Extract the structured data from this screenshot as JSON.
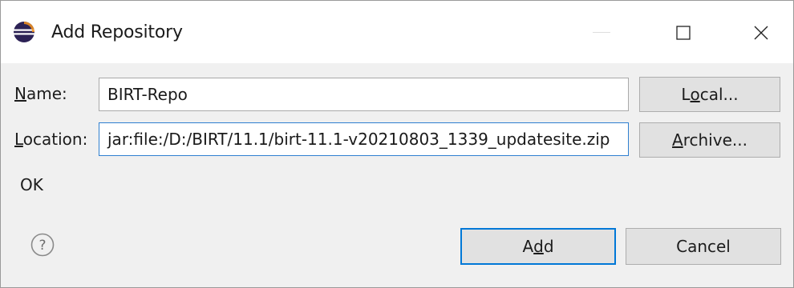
{
  "window": {
    "title": "Add Repository",
    "icon": "eclipse-icon",
    "controls": {
      "maximize_icon": "maximize-icon",
      "close_icon": "close-icon"
    }
  },
  "form": {
    "name_label_prefix": "",
    "name_label_mnemonic": "N",
    "name_label_rest": "ame:",
    "name_value": "BIRT-Repo",
    "location_label_prefix": "",
    "location_label_mnemonic": "L",
    "location_label_rest": "ocation:",
    "location_value": "jar:file:/D:/BIRT/11.1/birt-11.1-v20210803_1339_updatesite.zip"
  },
  "buttons": {
    "local_prefix": "L",
    "local_mnemonic": "o",
    "local_rest": "cal...",
    "archive_prefix": "",
    "archive_mnemonic": "A",
    "archive_rest": "rchive...",
    "add_prefix": "A",
    "add_mnemonic": "d",
    "add_rest": "d",
    "cancel_label": "Cancel"
  },
  "status": {
    "message": "OK"
  },
  "help": {
    "icon": "help-icon",
    "glyph": "?"
  },
  "colors": {
    "focus": "#0078d7",
    "dialog_bg": "#f0f0f0",
    "titlebar_bg": "#ffffff"
  }
}
